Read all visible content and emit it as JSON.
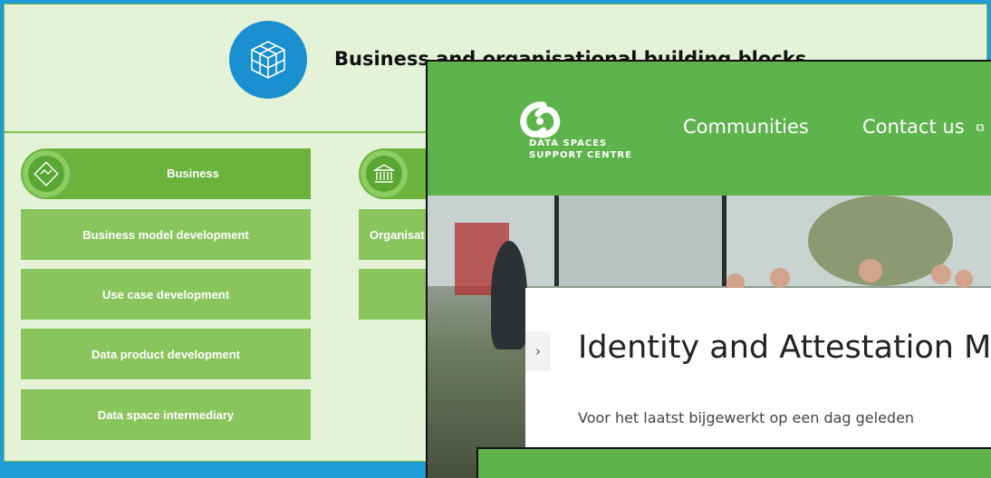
{
  "bb": {
    "title": "Business and organisational building blocks"
  },
  "business": {
    "category": "Business",
    "items": [
      "Business model development",
      "Use case development",
      "Data product development",
      "Data space intermediary"
    ]
  },
  "organisational": {
    "items": [
      "Organisat",
      ""
    ]
  },
  "overlay": {
    "logo_line1": "DATA SPACES",
    "logo_line2": "SUPPORT CENTRE",
    "nav": [
      "Communities",
      "Contact us"
    ],
    "nav_external_icon": "⧉",
    "card_title": "Identity and Attestation M",
    "card_sub": "Voor het laatst bijgewerkt op een dag geleden",
    "chevron": "›"
  },
  "colors": {
    "frame": "#1f9bd6",
    "panel_bg": "#e4f2d8",
    "category_green": "#6cb33e",
    "item_green": "#8ac45d",
    "dssc_green": "#5fb34c",
    "icon_blue": "#1a8fd0"
  }
}
